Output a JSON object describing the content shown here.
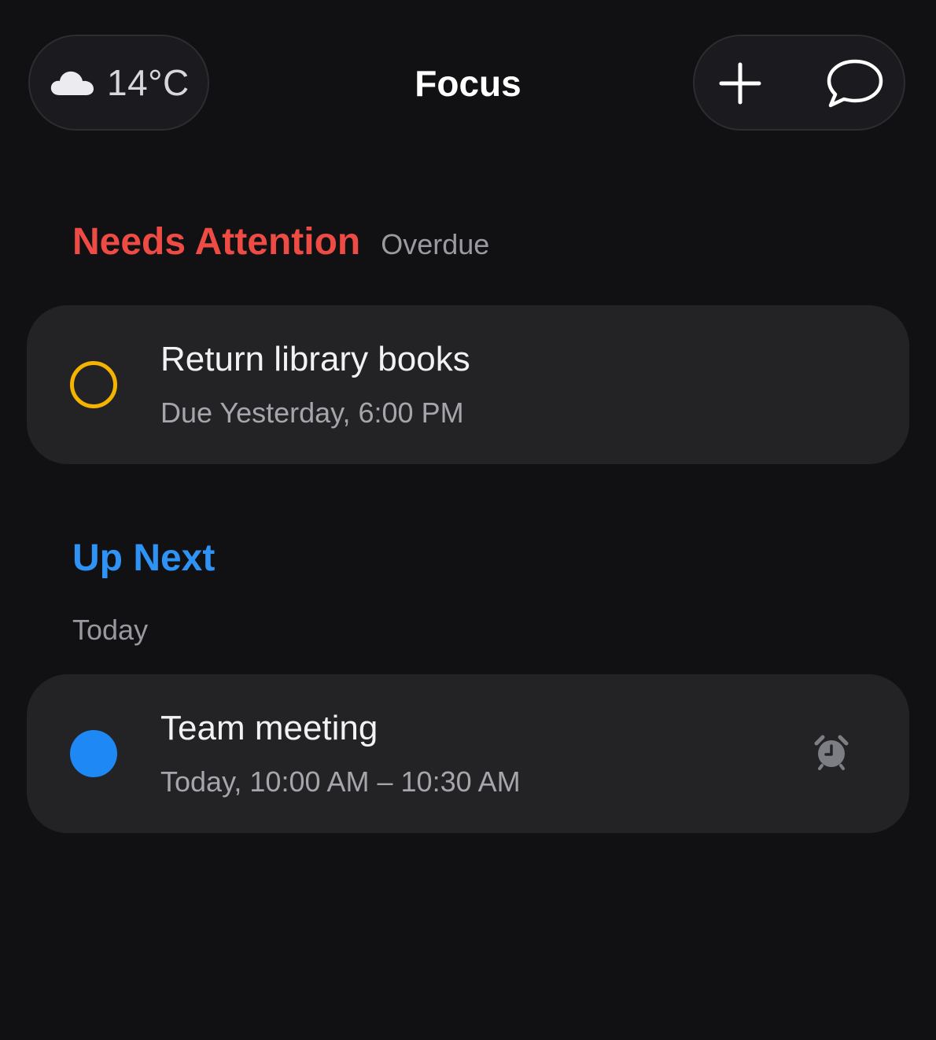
{
  "header": {
    "weather": {
      "icon": "cloud-icon",
      "temperature": "14°C"
    },
    "title": "Focus",
    "actions": [
      {
        "icon": "plus-icon",
        "name": "add"
      },
      {
        "icon": "chat-bubble-icon",
        "name": "chat"
      }
    ]
  },
  "sections": {
    "needs_attention": {
      "title": "Needs Attention",
      "subtitle": "Overdue",
      "color": "#ef4b45",
      "items": [
        {
          "title": "Return library books",
          "meta": "Due Yesterday, 6:00 PM",
          "status_icon": "empty-circle-icon",
          "status_color": "#f5b400"
        }
      ]
    },
    "up_next": {
      "title": "Up Next",
      "color": "#2f93f6",
      "groups": [
        {
          "label": "Today",
          "items": [
            {
              "title": "Team meeting",
              "meta": "Today, 10:00 AM – 10:30 AM",
              "status_icon": "filled-circle-icon",
              "status_color": "#1e88f5",
              "trailing_icon": "alarm-clock-icon"
            }
          ]
        }
      ]
    }
  },
  "colors": {
    "background": "#111114",
    "card": "#232326"
  }
}
